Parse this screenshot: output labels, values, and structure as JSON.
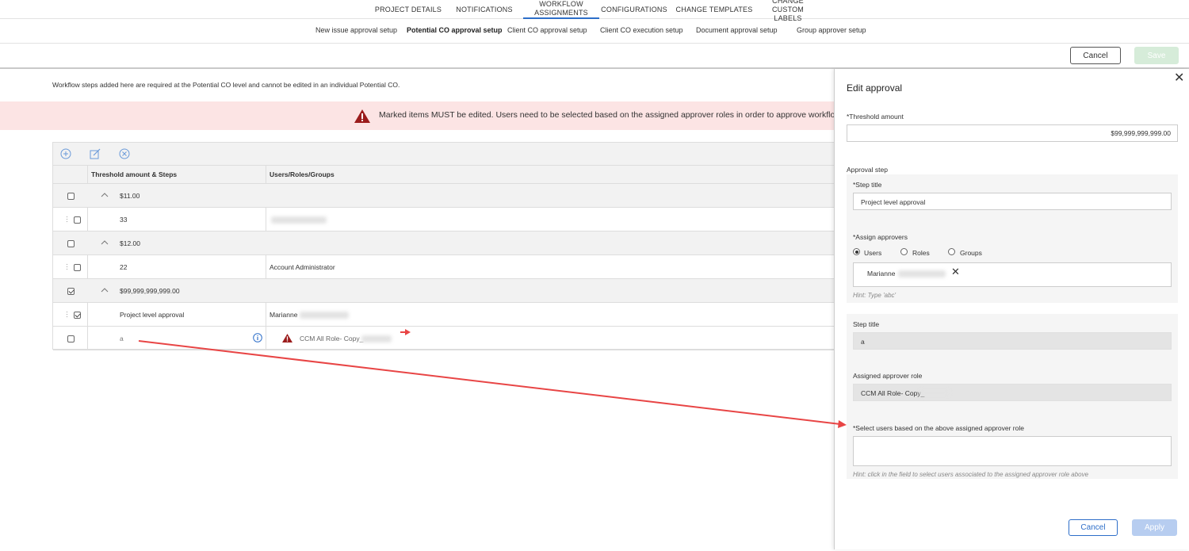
{
  "top_tabs": {
    "project_details": "PROJECT DETAILS",
    "notifications": "NOTIFICATIONS",
    "workflow_assignments": "WORKFLOW ASSIGNMENTS",
    "configurations": "CONFIGURATIONS",
    "change_templates": "CHANGE TEMPLATES",
    "change_custom_labels": "CHANGE CUSTOM LABELS"
  },
  "sub_tabs": {
    "new_issue": "New issue approval setup",
    "potential_co": "Potential CO approval setup",
    "client_co": "Client CO approval setup",
    "client_co_execution": "Client CO execution setup",
    "document": "Document approval setup",
    "group_approver": "Group approver setup"
  },
  "actions": {
    "cancel": "Cancel",
    "save": "Save"
  },
  "info_text": "Workflow steps added here are required at the Potential CO level and cannot be edited in an individual Potential CO.",
  "banner": {
    "message": "Marked items MUST be edited. Users need to be selected based on the assigned approver roles in order to approve workflows."
  },
  "table": {
    "columns": {
      "threshold": "Threshold amount & Steps",
      "users": "Users/Roles/Groups"
    },
    "group1": {
      "amount": "$11.00",
      "checked": false
    },
    "row1": {
      "step": "33",
      "user": "",
      "checked": false
    },
    "group2": {
      "amount": "$12.00",
      "checked": false
    },
    "row2": {
      "step": "22",
      "user": "Account Administrator",
      "checked": false
    },
    "group3": {
      "amount": "$99,999,999,999.00",
      "checked": true
    },
    "row3": {
      "step": "Project level approval",
      "user": "Marianne",
      "checked": true
    },
    "row4": {
      "step": "a",
      "user": "CCM All Role- Copy_",
      "checked": false
    }
  },
  "panel": {
    "title": "Edit approval",
    "threshold_label": "*Threshold amount",
    "threshold_value": "$99,999,999,999.00",
    "approval_step_label": "Approval step",
    "step_title_label": "*Step title",
    "step_title_value": "Project level approval",
    "assign_approvers_label": "*Assign approvers",
    "radio_users": "Users",
    "radio_roles": "Roles",
    "radio_groups": "Groups",
    "selected_user": "Marianne",
    "hint1": "Hint: Type 'abc'",
    "step_title2_label": "Step title",
    "step_title2_value": "a",
    "assigned_role_label": "Assigned approver role",
    "assigned_role_value": "CCM All Role- Copy_",
    "select_users_label": "*Select users based on the above assigned approver role",
    "hint2": "Hint: click in the field to select users associated to the assigned approver role above",
    "cancel": "Cancel",
    "apply": "Apply"
  },
  "colors": {
    "accent": "#2d6ec9",
    "banner_bg": "#fce4e4",
    "warning": "#9b1c1c",
    "annotation_arrow": "#e84545",
    "save_disabled": "#d6ecd9"
  },
  "icons": [
    "add-circle-icon",
    "edit-icon",
    "delete-circle-icon",
    "warning-icon",
    "info-icon",
    "chevron-up-icon",
    "close-icon",
    "remove-x-icon"
  ]
}
